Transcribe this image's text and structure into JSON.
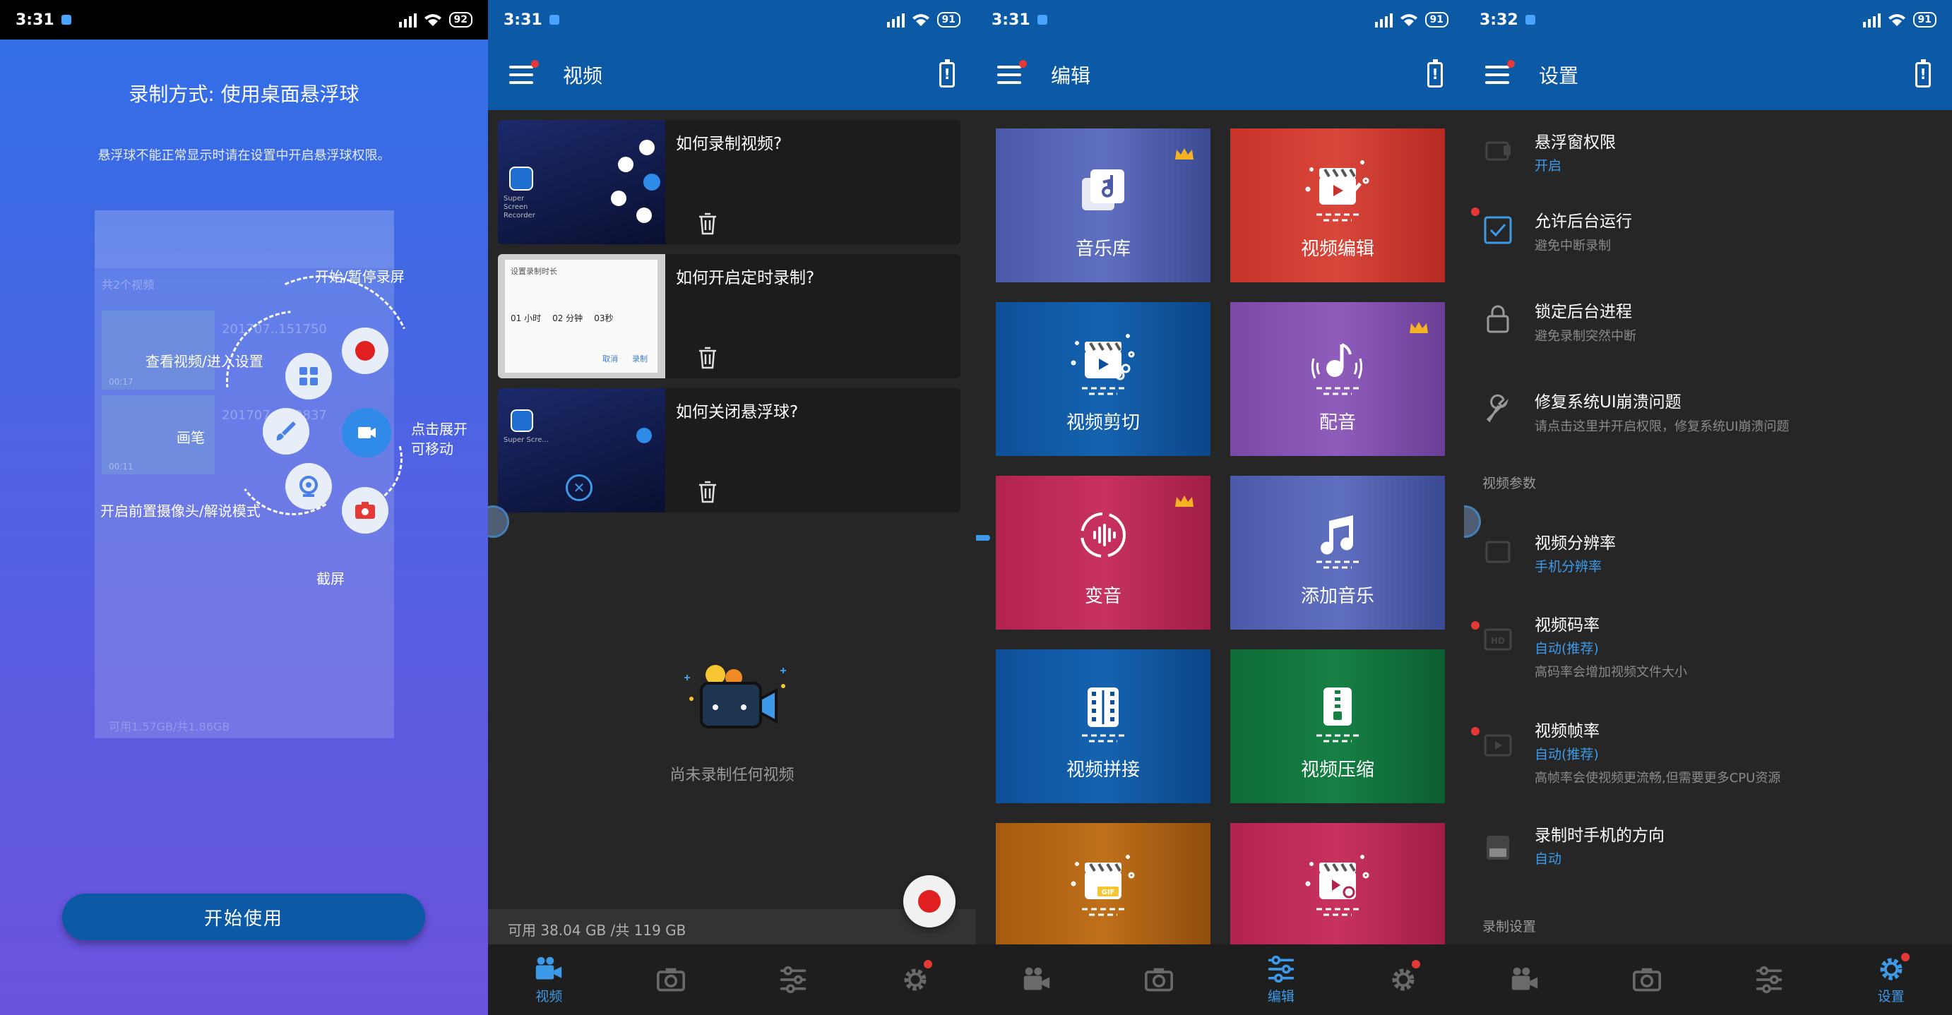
{
  "colors": {
    "accent": "#0c5aa6",
    "blue_text": "#3d9ae8",
    "record_red": "#e02020"
  },
  "p1": {
    "time": "3:31",
    "battery": "92",
    "title": "录制方式: 使用桌面悬浮球",
    "subtitle": "悬浮球不能正常显示时请在设置中开启悬浮球权限。",
    "mock": {
      "count": "共2个视频",
      "row1": "201707..151750",
      "row2": "201707..150837",
      "time1": "00:17",
      "time2": "00:11",
      "footer": "可用1.57GB/共1.86GB"
    },
    "labels": {
      "start_pause": "开始/暂停录屏",
      "view_settings": "查看视频/进入设置",
      "brush": "画笔",
      "expand": "点击展开",
      "movable": "可移动",
      "camera_mode": "开启前置摄像头/解说模式",
      "screenshot": "截屏"
    },
    "start_button": "开始使用"
  },
  "p2": {
    "time": "3:31",
    "battery": "91",
    "title": "视频",
    "videos": [
      {
        "title": "如何录制视频?"
      },
      {
        "title": "如何开启定时录制?"
      },
      {
        "title": "如何关闭悬浮球?"
      }
    ],
    "thumb_text": {
      "brand": "Super Screen Recorder",
      "brand_short": "Super Scre...",
      "timer_title": "设置录制时长",
      "h": "01 小时",
      "m": "02 分钟",
      "s": "03秒",
      "cancel": "取消",
      "record": "录制"
    },
    "empty": "尚未录制任何视频",
    "storage": "可用 38.04 GB /共 119 GB",
    "nav": {
      "video": "视频",
      "edit": "编辑",
      "settings": "设置"
    }
  },
  "p3": {
    "time": "3:31",
    "battery": "91",
    "title": "编辑",
    "tiles": [
      {
        "label": "音乐库",
        "icon": "music-library-icon",
        "premium": true
      },
      {
        "label": "视频编辑",
        "icon": "video-edit-icon",
        "premium": false
      },
      {
        "label": "视频剪切",
        "icon": "video-cut-icon",
        "premium": false
      },
      {
        "label": "配音",
        "icon": "dubbing-icon",
        "premium": true
      },
      {
        "label": "变音",
        "icon": "voice-change-icon",
        "premium": true
      },
      {
        "label": "添加音乐",
        "icon": "add-music-icon",
        "premium": false
      },
      {
        "label": "视频拼接",
        "icon": "video-merge-icon",
        "premium": false
      },
      {
        "label": "视频压缩",
        "icon": "video-compress-icon",
        "premium": false
      },
      {
        "label": "",
        "icon": "gif-icon",
        "premium": false
      },
      {
        "label": "",
        "icon": "video-reverse-icon",
        "premium": false
      }
    ]
  },
  "p4": {
    "time": "3:32",
    "battery": "91",
    "title": "设置",
    "items": [
      {
        "title": "悬浮窗权限",
        "value": "开启"
      },
      {
        "title": "允许后台运行",
        "sub": "避免中断录制"
      },
      {
        "title": "锁定后台进程",
        "sub": "避免录制突然中断"
      },
      {
        "title": "修复系统UI崩溃问题",
        "sub": "请点击这里并开启权限，修复系统UI崩溃问题"
      }
    ],
    "section_video": "视频参数",
    "video_items": [
      {
        "title": "视频分辨率",
        "value": "手机分辨率"
      },
      {
        "title": "视频码率",
        "value": "自动(推荐)",
        "sub": "高码率会增加视频文件大小"
      },
      {
        "title": "视频帧率",
        "value": "自动(推荐)",
        "sub": "高帧率会使视频更流畅,但需要更多CPU资源"
      },
      {
        "title": "录制时手机的方向",
        "value": "自动"
      }
    ],
    "section_record": "录制设置"
  }
}
